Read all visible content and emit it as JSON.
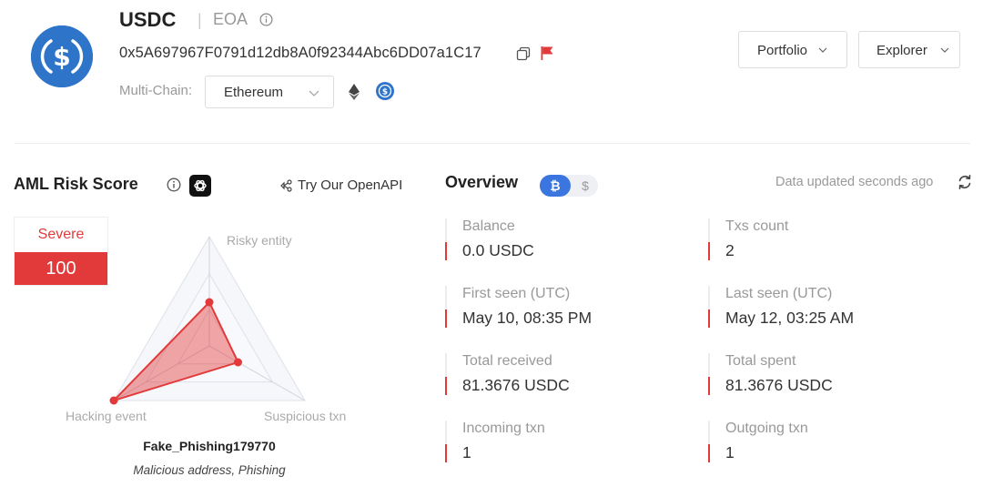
{
  "header": {
    "token_name": "USDC",
    "separator": "|",
    "account_type": "EOA",
    "address": "0x5A697967F0791d12db8A0f92344Abc6DD07a1C17",
    "multichain_label": "Multi-Chain:",
    "chain_selected": "Ethereum",
    "buttons": {
      "portfolio": "Portfolio",
      "explorer": "Explorer"
    },
    "icons": {
      "logo": "usdc-logo-icon",
      "info": "info-icon",
      "copy": "copy-icon",
      "flag": "flag-icon",
      "chain_dropdown": "chevron-down-icon",
      "eth": "ethereum-icon",
      "usdc": "usdc-icon"
    }
  },
  "aml": {
    "title": "AML Risk Score",
    "openapi_link": "Try Our OpenAPI",
    "severity_label": "Severe",
    "score": "100",
    "radar": {
      "axes": [
        "Risky entity",
        "Hacking event",
        "Suspicious txn"
      ],
      "values": [
        0.4,
        1.0,
        0.3
      ]
    },
    "entity_name": "Fake_Phishing179770",
    "entity_tags": "Malicious address, Phishing",
    "icons": {
      "info": "info-icon",
      "chatgpt": "chatgpt-icon",
      "openapi": "api-icon"
    }
  },
  "overview": {
    "title": "Overview",
    "toggle": {
      "active": "₿",
      "inactive": "$"
    },
    "updated_text": "Data updated seconds ago",
    "stats": [
      {
        "label": "Balance",
        "value": "0.0 USDC"
      },
      {
        "label": "Txs count",
        "value": "2"
      },
      {
        "label": "First seen (UTC)",
        "value": "May 10, 08:35 PM"
      },
      {
        "label": "Last seen (UTC)",
        "value": "May 12, 03:25 AM"
      },
      {
        "label": "Total received",
        "value": "81.3676 USDC"
      },
      {
        "label": "Total spent",
        "value": "81.3676 USDC"
      },
      {
        "label": "Incoming txn",
        "value": "1"
      },
      {
        "label": "Outgoing txn",
        "value": "1"
      }
    ],
    "icons": {
      "refresh": "refresh-icon"
    }
  },
  "colors": {
    "severe": "#e23a3a",
    "brand_blue": "#2e74c9",
    "toggle_active": "#3b75e0"
  }
}
